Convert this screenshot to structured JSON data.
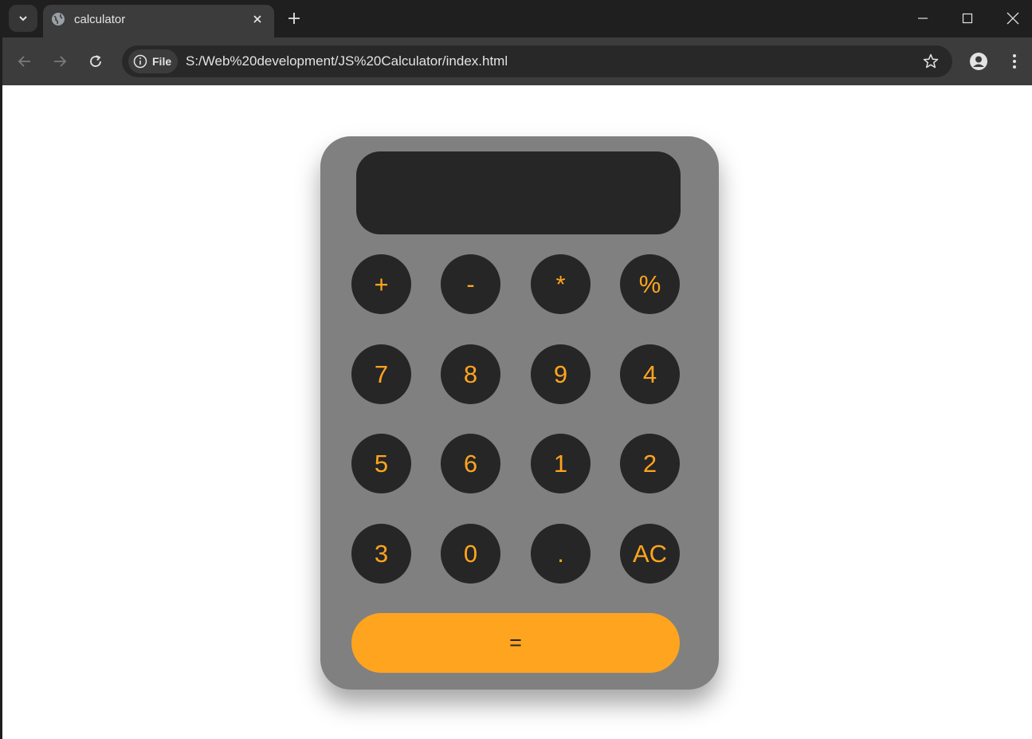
{
  "browser": {
    "tab_title": "calculator",
    "security_chip_label": "File",
    "url": "S:/Web%20development/JS%20Calculator/index.html"
  },
  "calculator": {
    "display_value": "",
    "rows": [
      [
        "+",
        "-",
        "*",
        "%"
      ],
      [
        "7",
        "8",
        "9",
        "4"
      ],
      [
        "5",
        "6",
        "1",
        "2"
      ],
      [
        "3",
        "0",
        ".",
        "AC"
      ]
    ],
    "equals_label": "=",
    "colors": {
      "body": "#808080",
      "key": "#262626",
      "accent": "#ffa41e"
    }
  }
}
